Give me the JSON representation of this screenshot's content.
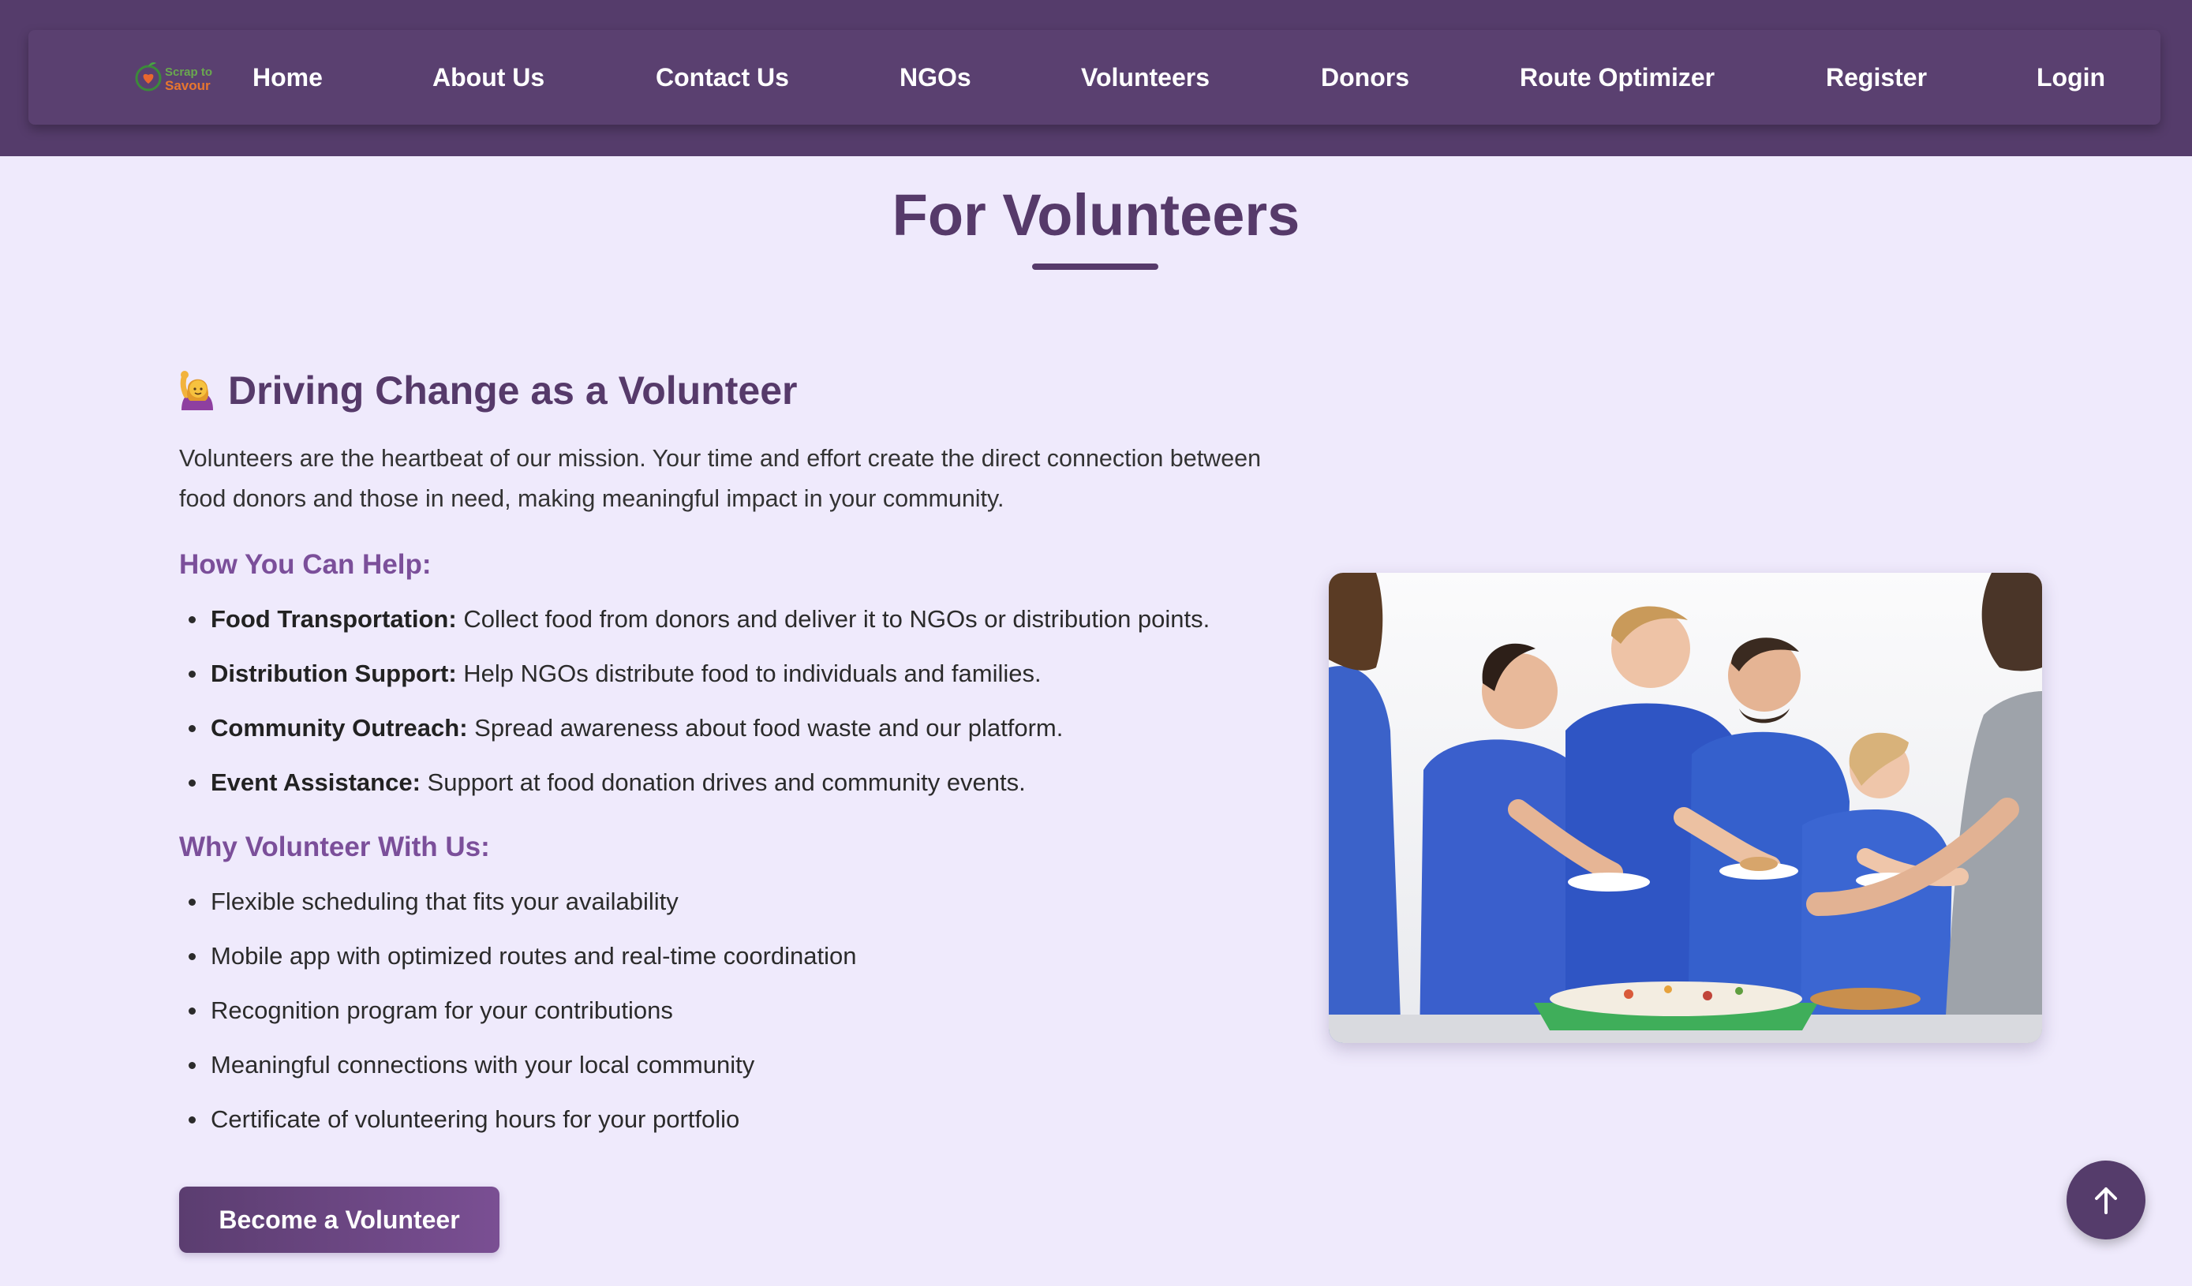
{
  "nav": {
    "logo_text_top": "Scrap to",
    "logo_text_bottom": "Savour",
    "links": [
      "Home",
      "About Us",
      "Contact Us",
      "NGOs",
      "Volunteers",
      "Donors",
      "Route Optimizer",
      "Register",
      "Login"
    ]
  },
  "page": {
    "title": "For Volunteers"
  },
  "section": {
    "icon": "person-raising-hand-emoji",
    "heading": "Driving Change as a Volunteer",
    "intro": "Volunteers are the heartbeat of our mission. Your time and effort create the direct connection between food donors and those in need, making meaningful impact in your community.",
    "help_heading": "How You Can Help:",
    "help_items": [
      {
        "term": "Food Transportation:",
        "text": " Collect food from donors and deliver it to NGOs or distribution points."
      },
      {
        "term": "Distribution Support:",
        "text": " Help NGOs distribute food to individuals and families."
      },
      {
        "term": "Community Outreach:",
        "text": " Spread awareness about food waste and our platform."
      },
      {
        "term": "Event Assistance:",
        "text": " Support at food donation drives and community events."
      }
    ],
    "why_heading": "Why Volunteer With Us:",
    "why_items": [
      "Flexible scheduling that fits your availability",
      "Mobile app with optimized routes and real-time coordination",
      "Recognition program for your contributions",
      "Meaningful connections with your local community",
      "Certificate of volunteering hours for your portfolio"
    ],
    "cta": "Become a Volunteer"
  },
  "image": {
    "subject": "volunteers-serving-food-photo"
  },
  "colors": {
    "header": "#553c6b",
    "accent": "#563a6a",
    "subheading": "#7b4f9a",
    "background": "#efeafc"
  },
  "icons": {
    "scroll_top": "arrow-up-icon"
  }
}
